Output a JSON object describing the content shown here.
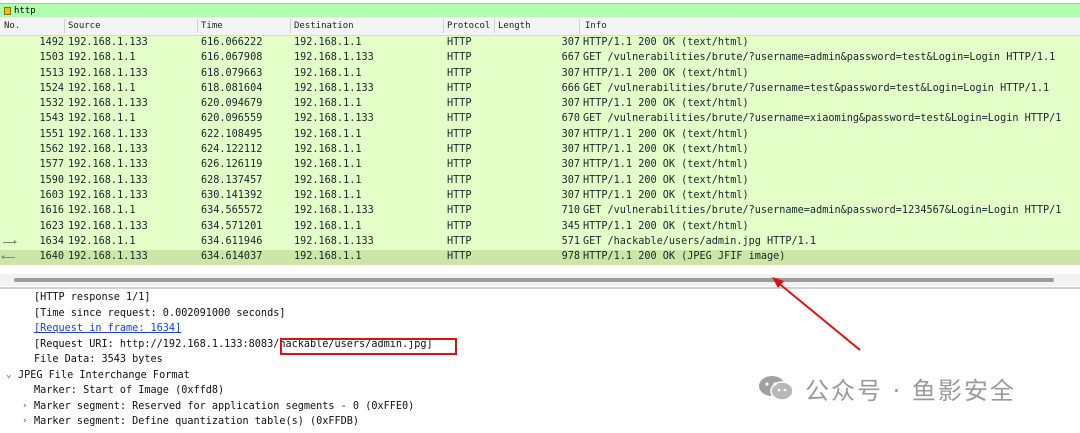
{
  "filter": {
    "text": "http"
  },
  "columns": {
    "no": "No.",
    "source": "Source",
    "time": "Time",
    "destination": "Destination",
    "protocol": "Protocol",
    "length": "Length",
    "info": "Info"
  },
  "packets": [
    {
      "no": "1492",
      "src": "192.168.1.133",
      "time": "616.066222",
      "dst": "192.168.1.1",
      "proto": "HTTP",
      "len": "307",
      "info": "HTTP/1.1 200 OK  (text/html)"
    },
    {
      "no": "1503",
      "src": "192.168.1.1",
      "time": "616.067908",
      "dst": "192.168.1.133",
      "proto": "HTTP",
      "len": "667",
      "info": "GET /vulnerabilities/brute/?username=admin&password=test&Login=Login HTTP/1.1"
    },
    {
      "no": "1513",
      "src": "192.168.1.133",
      "time": "618.079663",
      "dst": "192.168.1.1",
      "proto": "HTTP",
      "len": "307",
      "info": "HTTP/1.1 200 OK  (text/html)"
    },
    {
      "no": "1524",
      "src": "192.168.1.1",
      "time": "618.081604",
      "dst": "192.168.1.133",
      "proto": "HTTP",
      "len": "666",
      "info": "GET /vulnerabilities/brute/?username=test&password=test&Login=Login HTTP/1.1"
    },
    {
      "no": "1532",
      "src": "192.168.1.133",
      "time": "620.094679",
      "dst": "192.168.1.1",
      "proto": "HTTP",
      "len": "307",
      "info": "HTTP/1.1 200 OK  (text/html)"
    },
    {
      "no": "1543",
      "src": "192.168.1.1",
      "time": "620.096559",
      "dst": "192.168.1.133",
      "proto": "HTTP",
      "len": "670",
      "info": "GET /vulnerabilities/brute/?username=xiaoming&password=test&Login=Login HTTP/1"
    },
    {
      "no": "1551",
      "src": "192.168.1.133",
      "time": "622.108495",
      "dst": "192.168.1.1",
      "proto": "HTTP",
      "len": "307",
      "info": "HTTP/1.1 200 OK  (text/html)"
    },
    {
      "no": "1562",
      "src": "192.168.1.133",
      "time": "624.122112",
      "dst": "192.168.1.1",
      "proto": "HTTP",
      "len": "307",
      "info": "HTTP/1.1 200 OK  (text/html)"
    },
    {
      "no": "1577",
      "src": "192.168.1.133",
      "time": "626.126119",
      "dst": "192.168.1.1",
      "proto": "HTTP",
      "len": "307",
      "info": "HTTP/1.1 200 OK  (text/html)"
    },
    {
      "no": "1590",
      "src": "192.168.1.133",
      "time": "628.137457",
      "dst": "192.168.1.1",
      "proto": "HTTP",
      "len": "307",
      "info": "HTTP/1.1 200 OK  (text/html)"
    },
    {
      "no": "1603",
      "src": "192.168.1.133",
      "time": "630.141392",
      "dst": "192.168.1.1",
      "proto": "HTTP",
      "len": "307",
      "info": "HTTP/1.1 200 OK  (text/html)"
    },
    {
      "no": "1616",
      "src": "192.168.1.1",
      "time": "634.565572",
      "dst": "192.168.1.133",
      "proto": "HTTP",
      "len": "710",
      "info": "GET /vulnerabilities/brute/?username=admin&password=1234567&Login=Login HTTP/1"
    },
    {
      "no": "1623",
      "src": "192.168.1.133",
      "time": "634.571201",
      "dst": "192.168.1.1",
      "proto": "HTTP",
      "len": "345",
      "info": "HTTP/1.1 200 OK  (text/html)"
    },
    {
      "no": "1634",
      "src": "192.168.1.1",
      "time": "634.611946",
      "dst": "192.168.1.133",
      "proto": "HTTP",
      "len": "571",
      "info": "GET /hackable/users/admin.jpg HTTP/1.1"
    },
    {
      "no": "1640",
      "src": "192.168.1.133",
      "time": "634.614037",
      "dst": "192.168.1.1",
      "proto": "HTTP",
      "len": "978",
      "info": "HTTP/1.1 200 OK  (JPEG JFIF image)"
    }
  ],
  "details": {
    "response_num": "[HTTP response 1/1]",
    "time_since": "[Time since request: 0.002091000 seconds]",
    "request_link": "[Request in frame: 1634]",
    "uri_prefix": "[Request URI: http://192.168.1.133:8083",
    "uri_path": "/hackable/users/admin.jpg]",
    "file_data": "File Data: 3543 bytes",
    "jpeg_header": "JPEG File Interchange Format",
    "marker_soi": "Marker: Start of Image (0xffd8)",
    "marker_app0": "Marker segment: Reserved for application segments - 0 (0xFFE0)",
    "marker_dqt": "Marker segment: Define quantization table(s) (0xFFDB)"
  },
  "watermark": {
    "text": "公众号 · 鱼影安全"
  },
  "colors": {
    "row_bg": "#e4ffc7",
    "row_selected": "#cde6a8",
    "filter_bg": "#afffaf",
    "annotation": "#e01010"
  }
}
